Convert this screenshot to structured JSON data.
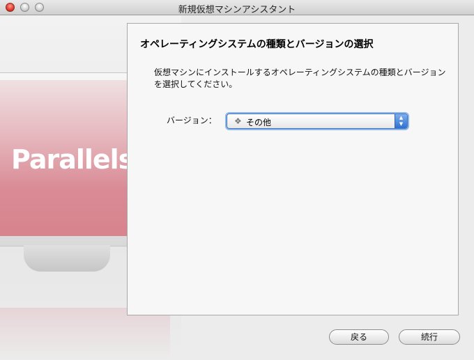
{
  "window": {
    "title": "新規仮想マシンアシスタント"
  },
  "artwork": {
    "logo_text": "Parallels",
    "trademark": "™"
  },
  "panel": {
    "heading": "オペレーティングシステムの種類とバージョンの選択",
    "description": "仮想マシンにインストールするオペレーティングシステムの種類とバージョンを選択してください。",
    "version_label": "バージョン：",
    "version_select": {
      "icon": "other-os-icon",
      "value": "その他"
    }
  },
  "buttons": {
    "back_label": "戻る",
    "continue_label": "続行"
  },
  "colors": {
    "accent": "#3b76c8",
    "close_button": "#e0392b"
  }
}
